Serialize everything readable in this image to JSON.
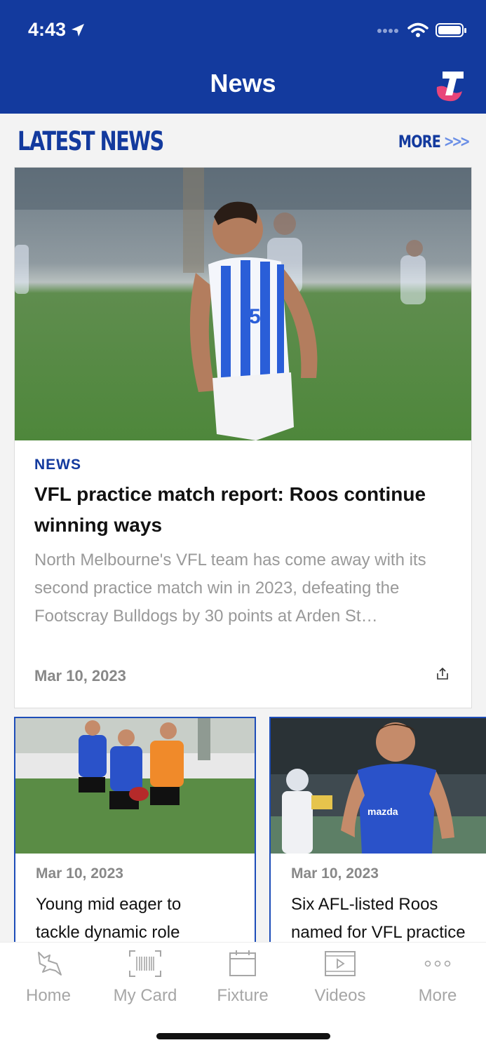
{
  "status_bar": {
    "time": "4:43"
  },
  "nav": {
    "title": "News"
  },
  "section": {
    "title": "LATEST NEWS",
    "more_label": "MORE",
    "more_chevrons": ">>>"
  },
  "featured": {
    "category": "NEWS",
    "title": "VFL practice match report: Roos continue winning ways",
    "summary": "North Melbourne's VFL team has come away with its second practice match win in 2023, defeating the Footscray Bulldogs by 30 points at Arden St…",
    "date": "Mar 10, 2023",
    "image_player_number": "5"
  },
  "cards": [
    {
      "date": "Mar 10, 2023",
      "title_line1": "Young mid eager to",
      "title_line2": "tackle dynamic role"
    },
    {
      "date": "Mar 10, 2023",
      "title_line1": "Six AFL-listed Roos",
      "title_line2": "named for VFL practice",
      "jersey_text": "mazda"
    }
  ],
  "tabs": [
    {
      "label": "Home",
      "icon": "kangaroo-icon"
    },
    {
      "label": "My Card",
      "icon": "barcode-icon"
    },
    {
      "label": "Fixture",
      "icon": "calendar-icon"
    },
    {
      "label": "Videos",
      "icon": "video-icon"
    },
    {
      "label": "More",
      "icon": "more-dots-icon"
    }
  ],
  "colors": {
    "brand_blue": "#133a9e",
    "accent_pink": "#e8457a",
    "grass_green": "#4d8a3a"
  }
}
